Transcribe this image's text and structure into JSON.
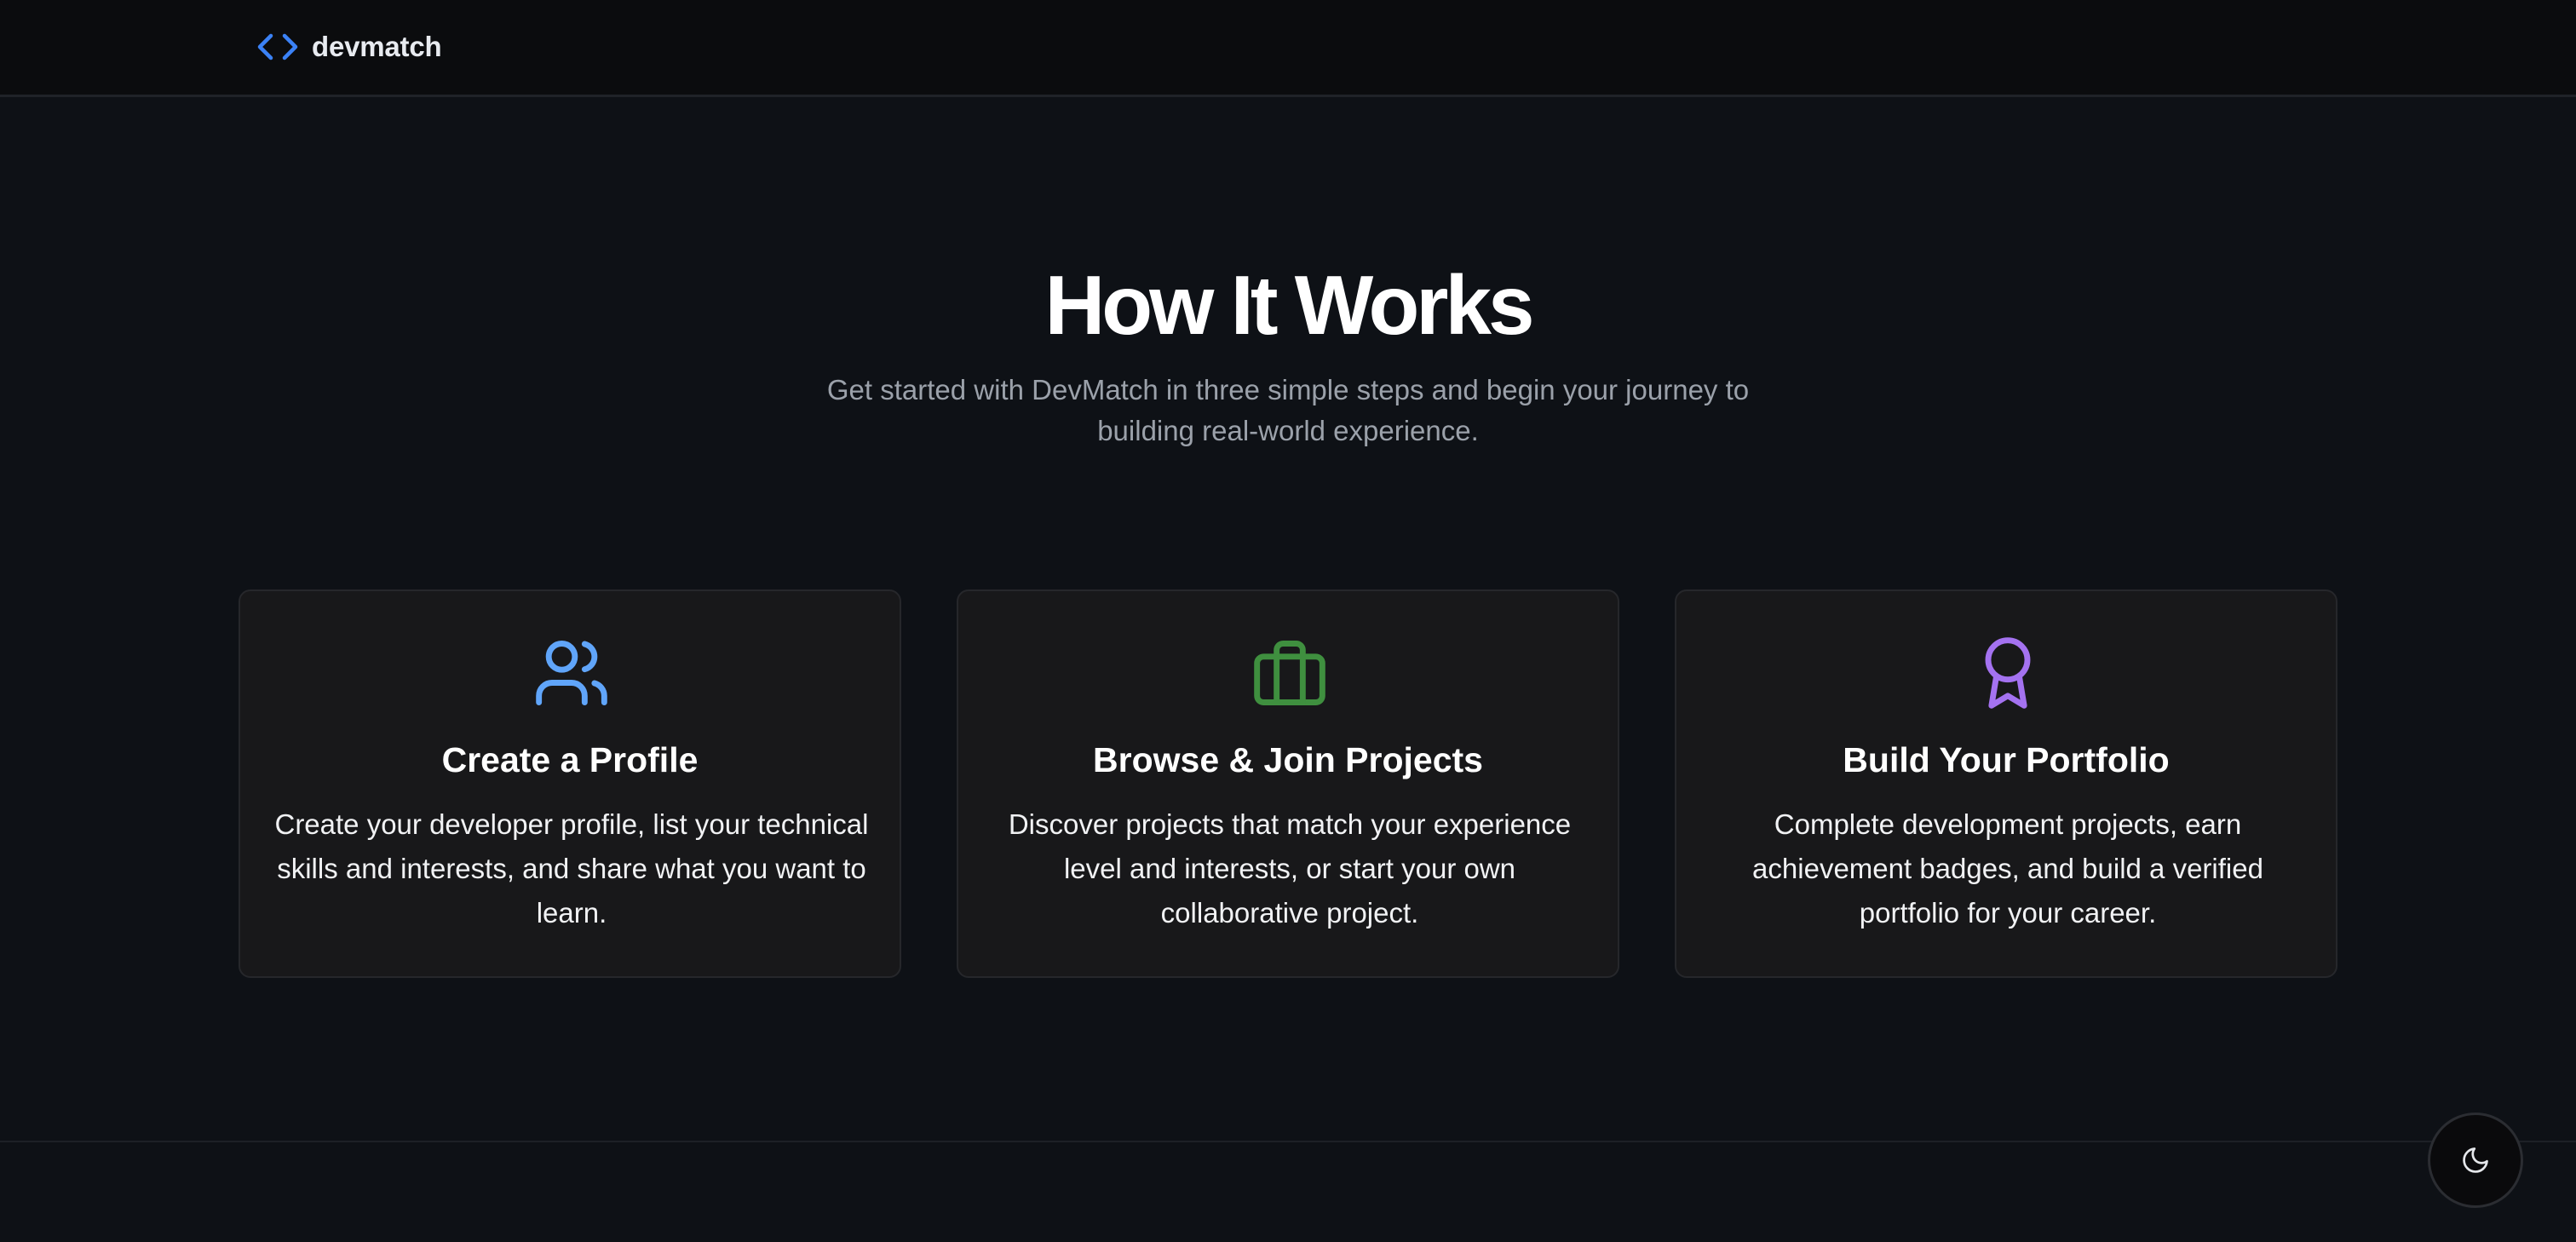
{
  "header": {
    "brand_name": "devmatch",
    "brand_icon": "code-brackets-icon",
    "brand_color": "#3b82f6"
  },
  "hero": {
    "title": "How It Works",
    "subtitle": "Get started with DevMatch in three simple steps and begin your journey to building real-world experience."
  },
  "steps": [
    {
      "icon": "users-icon",
      "icon_color": "#60a5fa",
      "title": "Create a Profile",
      "description": "Create your developer profile, list your technical skills and interests, and share what you want to learn."
    },
    {
      "icon": "briefcase-icon",
      "icon_color": "#3f8f3f",
      "title": "Browse & Join Projects",
      "description": "Discover projects that match your experience level and interests, or start your own collaborative project."
    },
    {
      "icon": "award-icon",
      "icon_color": "#a472f0",
      "title": "Build Your Portfolio",
      "description": "Complete development projects, earn achievement badges, and build a verified portfolio for your career."
    }
  ],
  "theme_toggle": {
    "icon": "moon-icon"
  }
}
